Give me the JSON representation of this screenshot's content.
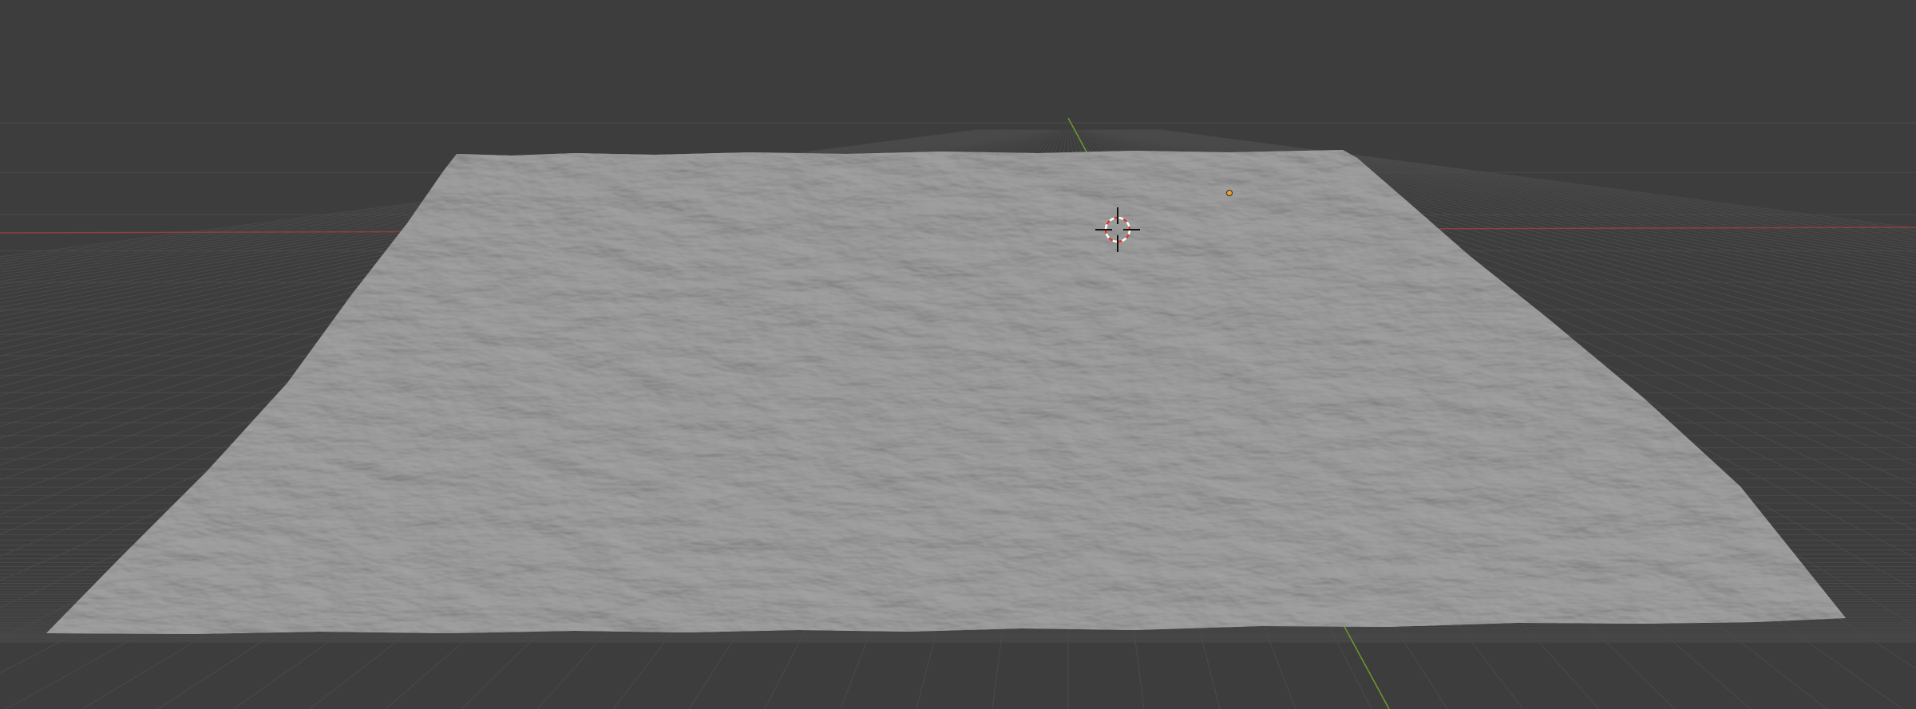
{
  "viewport": {
    "background_color": "#3d3d3d",
    "grid_line_color": "#4a4a4a",
    "x_axis_color": "#8a3f45",
    "y_axis_color": "#6d9a2a",
    "mesh_color": "#9a9a9a",
    "mesh_shadow_color": "#8a8a8a",
    "cursor_colors": [
      "#ffffff",
      "#e0352b",
      "#111111"
    ],
    "origin_dot_color": "#f0a030",
    "objects": [
      {
        "name": "terrain-plane",
        "kind": "displaced-plane-mesh"
      },
      {
        "name": "3d-cursor",
        "kind": "3d-cursor-icon"
      },
      {
        "name": "object-origin",
        "kind": "origin-marker"
      }
    ]
  }
}
